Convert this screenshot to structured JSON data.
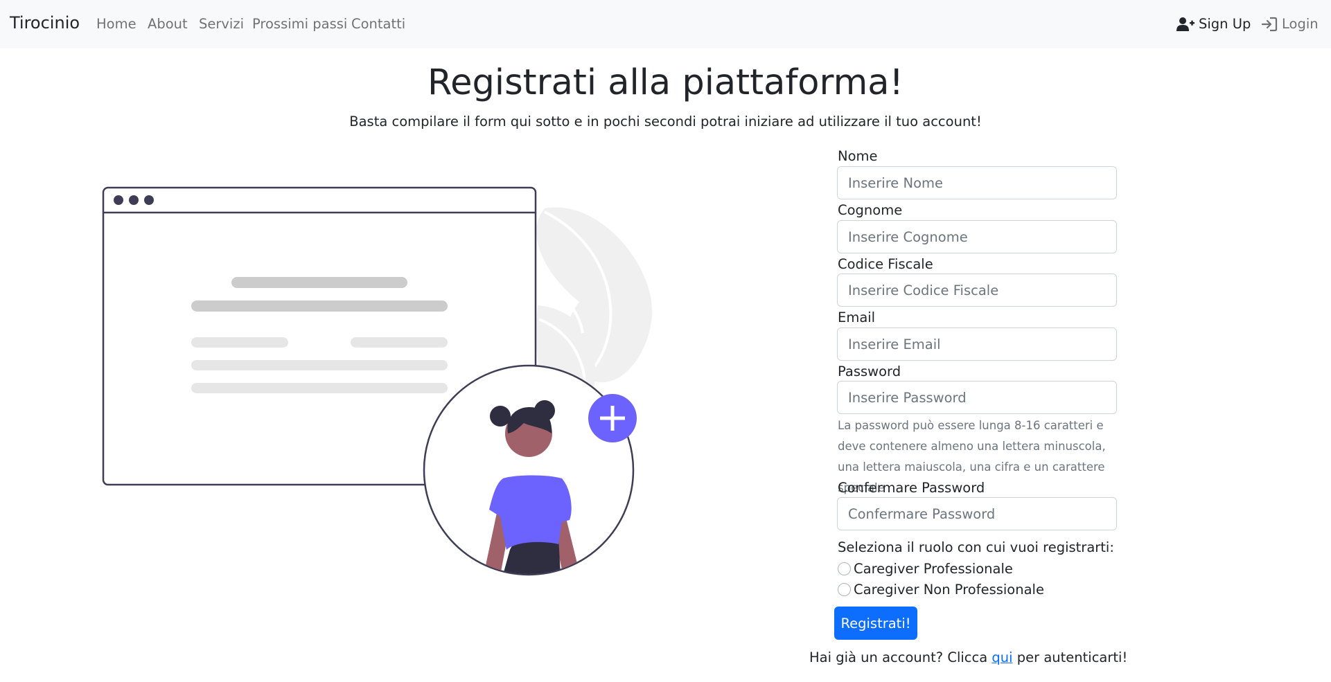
{
  "navbar": {
    "brand": "Tirocinio",
    "links": [
      {
        "label": "Home"
      },
      {
        "label": "About"
      },
      {
        "label": "Servizi"
      },
      {
        "label": "Prossimi passi"
      },
      {
        "label": "Contatti"
      }
    ],
    "signup": {
      "label": "Sign Up",
      "icon": "user-plus-icon"
    },
    "login": {
      "label": "Login",
      "icon": "sign-in-icon"
    }
  },
  "header": {
    "title": "Registrati alla piattaforma!",
    "subtitle": "Basta compilare il form qui sotto e in pochi secondi potrai iniziare ad utilizzare il tuo account!"
  },
  "form": {
    "fields": [
      {
        "label": "Nome",
        "placeholder": "Inserire Nome",
        "value": ""
      },
      {
        "label": "Cognome",
        "placeholder": "Inserire Cognome",
        "value": ""
      },
      {
        "label": "Codice Fiscale",
        "placeholder": "Inserire Codice Fiscale",
        "value": ""
      },
      {
        "label": "Email",
        "placeholder": "Inserire Email",
        "value": ""
      },
      {
        "label": "Password",
        "placeholder": "Inserire Password",
        "value": ""
      },
      {
        "label": "Confermare Password",
        "placeholder": "Confermare Password",
        "value": ""
      }
    ],
    "password_help": "La password può essere lunga 8-16 caratteri e deve contenere almeno una lettera minuscola, una lettera maiuscola, una cifra e un carattere speciale",
    "role_prompt": "Seleziona il ruolo con cui vuoi registrarti:",
    "roles": [
      {
        "label": "Caregiver Professionale",
        "checked": false
      },
      {
        "label": "Caregiver Non Professionale",
        "checked": false
      }
    ],
    "submit_label": "Registrati!",
    "footer": {
      "before": "Hai già un account? Clicca ",
      "link": "qui",
      "after": " per autenticarti!"
    }
  },
  "colors": {
    "primary": "#0d6efd",
    "navbar_bg": "#f8f9fa",
    "illustration_accent": "#6c63ff",
    "illustration_dark": "#3f3d56"
  }
}
